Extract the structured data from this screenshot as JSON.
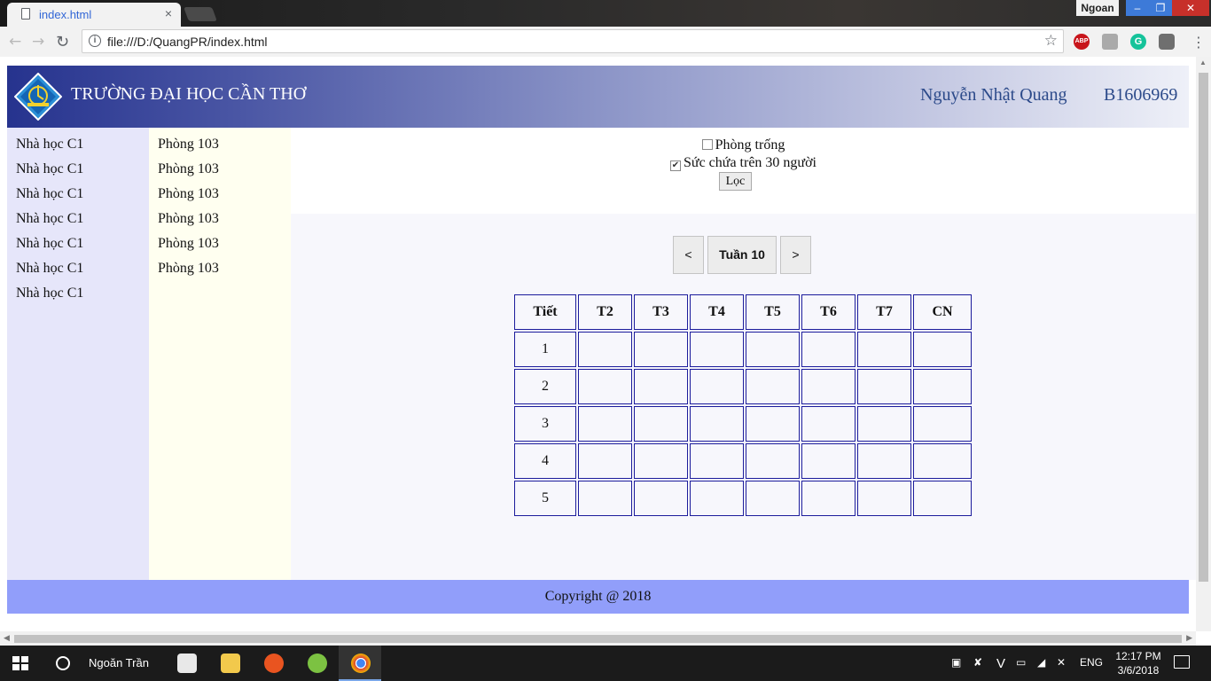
{
  "browser": {
    "tab_title": "index.html",
    "tab_close": "×",
    "url": "file:///D:/QuangPR/index.html",
    "profile_name": "Ngoan",
    "extensions": [
      "ABP",
      "",
      "G",
      ""
    ],
    "menu_glyph": "⋮"
  },
  "header": {
    "site_title": "TRƯỜNG ĐẠI HỌC CẦN THƠ",
    "user_name": "Nguyễn Nhật Quang",
    "student_id": "B1606969"
  },
  "buildings": [
    "Nhà học C1",
    "Nhà học C1",
    "Nhà học C1",
    "Nhà học C1",
    "Nhà học C1",
    "Nhà học C1",
    "Nhà học C1"
  ],
  "rooms": [
    "Phòng 103",
    "Phòng 103",
    "Phòng 103",
    "Phòng 103",
    "Phòng 103",
    "Phòng 103"
  ],
  "filters": {
    "empty_room": {
      "label": "Phòng trống",
      "checked": false
    },
    "capacity": {
      "label": "Sức chứa trên 30 người",
      "checked": true
    },
    "button": "Lọc"
  },
  "pager": {
    "prev": "<",
    "week_label": "Tuần 10",
    "next": ">"
  },
  "schedule": {
    "headers": [
      "Tiết",
      "T2",
      "T3",
      "T4",
      "T5",
      "T6",
      "T7",
      "CN"
    ],
    "periods": [
      "1",
      "2",
      "3",
      "4",
      "5"
    ]
  },
  "footer": {
    "text": "Copyright @ 2018"
  },
  "taskbar": {
    "user": "Ngoăn Trần",
    "language": "ENG",
    "time": "12:17 PM",
    "date": "3/6/2018"
  },
  "colors": {
    "header_start": "#26338e",
    "sidebar_buildings": "#e6e6fa",
    "sidebar_rooms": "#fffff0",
    "table_border": "#1c1c9c",
    "footer": "#919efa"
  }
}
